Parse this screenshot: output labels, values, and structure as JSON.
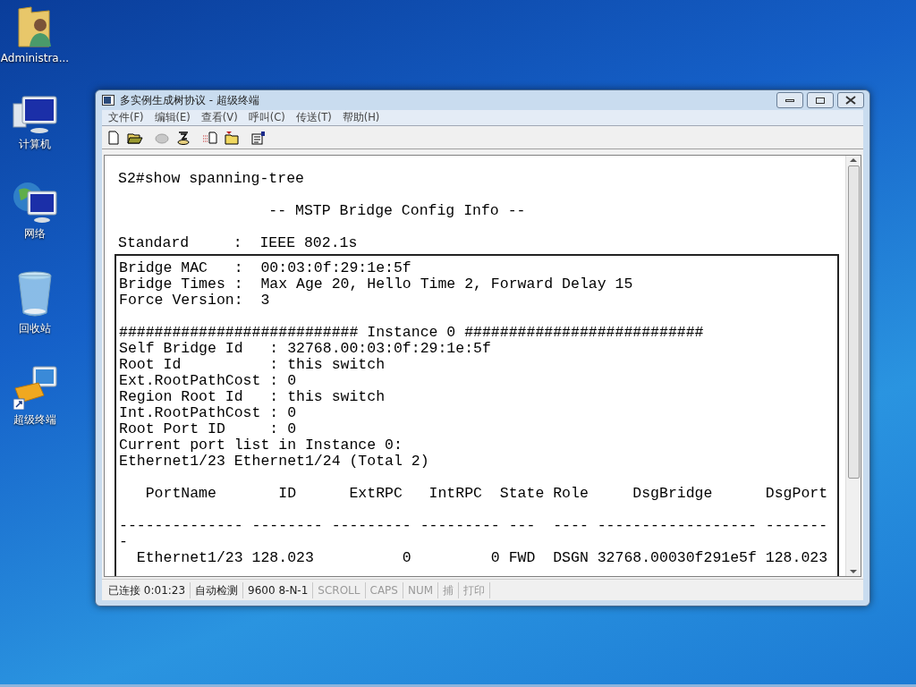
{
  "desktop_icons": [
    {
      "label": "Administra...",
      "kind": "user-folder"
    },
    {
      "label": "计算机",
      "kind": "computer"
    },
    {
      "label": "网络",
      "kind": "network"
    },
    {
      "label": "回收站",
      "kind": "recycle-bin"
    },
    {
      "label": "超级终端",
      "kind": "terminal-shortcut"
    }
  ],
  "window": {
    "title": "多实例生成树协议 - 超级终端"
  },
  "menu": [
    "文件(F)",
    "编辑(E)",
    "查看(V)",
    "呼叫(C)",
    "传送(T)",
    "帮助(H)"
  ],
  "toolbar": [
    {
      "kind": "new",
      "disabled": false
    },
    {
      "kind": "open",
      "disabled": false
    },
    {
      "kind": "disconnect",
      "disabled": true
    },
    {
      "kind": "dial",
      "disabled": false
    },
    {
      "kind": "send",
      "disabled": false
    },
    {
      "kind": "receive",
      "disabled": false
    },
    {
      "kind": "properties",
      "disabled": false
    }
  ],
  "terminal": {
    "top_blocks": [
      [
        "S2#show spanning-tree"
      ],
      [
        "                 -- MSTP Bridge Config Info --"
      ],
      [
        "Standard     :  IEEE 802.1s"
      ]
    ],
    "boxed_blocks": [
      [
        "Bridge MAC   :  00:03:0f:29:1e:5f",
        "Bridge Times :  Max Age 20, Hello Time 2, Forward Delay 15",
        "Force Version:  3"
      ],
      [
        "########################### Instance 0 ###########################",
        "Self Bridge Id   : 32768.00:03:0f:29:1e:5f",
        "Root Id          : this switch",
        "Ext.RootPathCost : 0",
        "Region Root Id   : this switch",
        "Int.RootPathCost : 0",
        "Root Port ID     : 0",
        "Current port list in Instance 0:",
        "Ethernet1/23 Ethernet1/24 (Total 2)"
      ],
      [
        "   PortName       ID      ExtRPC   IntRPC  State Role     DsgBridge      DsgPort"
      ],
      [
        "-------------- -------- --------- --------- ---  ---- ------------------ -------",
        "-",
        "  Ethernet1/23 128.023          0         0 FWD  DSGN 32768.00030f291e5f 128.023"
      ]
    ]
  },
  "status_bar": [
    {
      "text": "已连接 0:01:23",
      "disabled": false
    },
    {
      "text": "自动检测",
      "disabled": false
    },
    {
      "text": "9600 8-N-1",
      "disabled": false
    },
    {
      "text": "SCROLL",
      "disabled": true
    },
    {
      "text": "CAPS",
      "disabled": true
    },
    {
      "text": "NUM",
      "disabled": true
    },
    {
      "text": "捕",
      "disabled": true
    },
    {
      "text": "打印",
      "disabled": true
    }
  ]
}
